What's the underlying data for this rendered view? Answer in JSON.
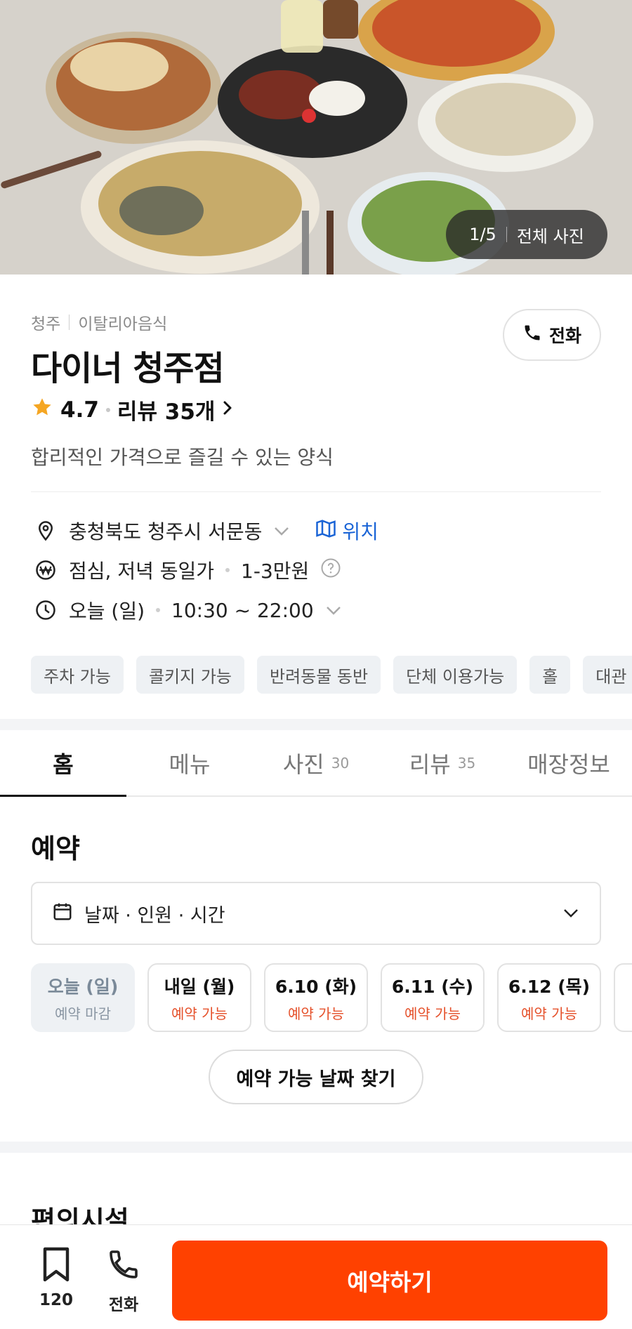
{
  "hero": {
    "counter": "1/5",
    "all_photos": "전체 사진"
  },
  "store": {
    "region": "청주",
    "category": "이탈리아음식",
    "call_label": "전화",
    "name": "다이너 청주점",
    "rating": "4.7",
    "review_link": "리뷰 35개",
    "tagline": "합리적인 가격으로 즐길 수 있는 양식"
  },
  "info": {
    "address": "충청북도 청주시 서문동",
    "location_label": "위치",
    "price_type": "점심, 저녁 동일가",
    "price_range": "1-3만원",
    "hours_day": "오늘 (일)",
    "hours_time": "10:30 ~ 22:00"
  },
  "tags": [
    "주차 가능",
    "콜키지 가능",
    "반려동물 동반",
    "단체 이용가능",
    "홀",
    "대관"
  ],
  "tabs": [
    {
      "label": "홈",
      "count": ""
    },
    {
      "label": "메뉴",
      "count": ""
    },
    {
      "label": "사진",
      "count": "30"
    },
    {
      "label": "리뷰",
      "count": "35"
    },
    {
      "label": "매장정보",
      "count": ""
    }
  ],
  "reservation": {
    "title": "예약",
    "selector_placeholder": "날짜 · 인원 · 시간",
    "dates": [
      {
        "day": "오늘 (일)",
        "status": "예약 마감"
      },
      {
        "day": "내일 (월)",
        "status": "예약 가능"
      },
      {
        "day": "6.10 (화)",
        "status": "예약 가능"
      },
      {
        "day": "6.11 (수)",
        "status": "예약 가능"
      },
      {
        "day": "6.12 (목)",
        "status": "예약 가능"
      }
    ],
    "find_button": "예약 가능 날짜 찾기"
  },
  "amenities": {
    "title": "편의시설"
  },
  "bottom": {
    "bookmark_count": "120",
    "call_label": "전화",
    "reserve_button": "예약하기"
  },
  "colors": {
    "accent": "#ff4100",
    "link": "#1a64d6",
    "available": "#e5502a"
  }
}
